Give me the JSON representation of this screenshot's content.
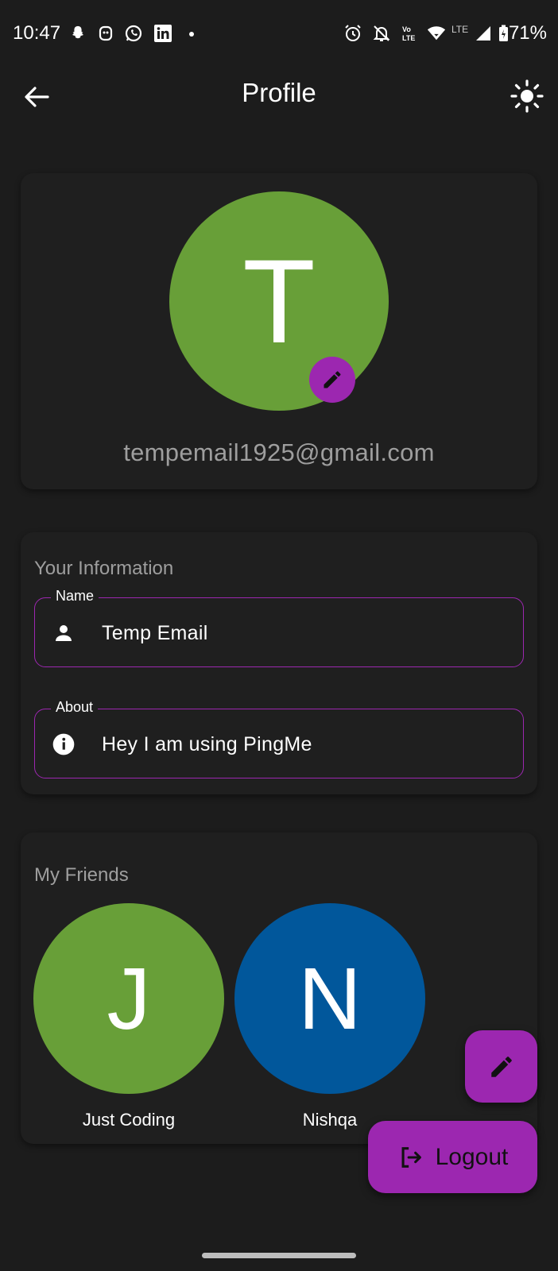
{
  "status_bar": {
    "time": "10:47",
    "battery": "71%",
    "network": "LTE"
  },
  "app_bar": {
    "title": "Profile",
    "back_icon": "arrow-left-icon",
    "theme_icon": "sun-icon"
  },
  "profile": {
    "avatar_letter": "T",
    "avatar_color": "#689f38",
    "email": "tempemail1925@gmail.com"
  },
  "info": {
    "section_title": "Your Information",
    "name": {
      "label": "Name",
      "value": "Temp Email",
      "icon": "person-icon"
    },
    "about": {
      "label": "About",
      "value": "Hey I am using PingMe",
      "icon": "info-icon"
    }
  },
  "friends": {
    "section_title": "My Friends",
    "items": [
      {
        "letter": "J",
        "name": "Just Coding",
        "color": "#689f38"
      },
      {
        "letter": "N",
        "name": "Nishqa",
        "color": "#01579b"
      }
    ]
  },
  "actions": {
    "logout_label": "Logout"
  },
  "colors": {
    "accent": "#9c27b0",
    "background": "#1c1c1c"
  }
}
